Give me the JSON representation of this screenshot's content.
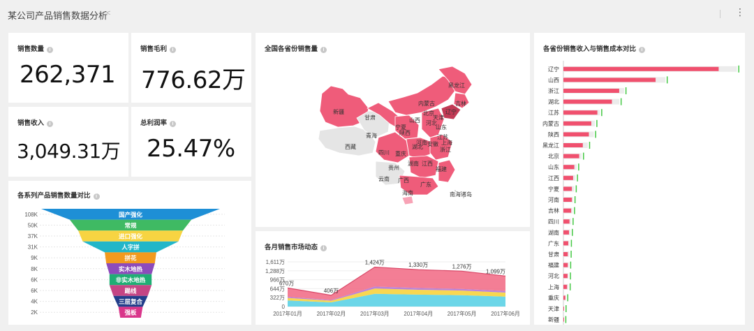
{
  "header": {
    "title": "某公司产品销售数据分析",
    "share_icon": "<",
    "more_icon": "⋮"
  },
  "kpis": [
    {
      "label": "销售数量",
      "value": "262,371"
    },
    {
      "label": "销售毛利",
      "value": "776.62万"
    },
    {
      "label": "销售收入",
      "value": "3,049.31万"
    },
    {
      "label": "总利润率",
      "value": "25.47%"
    }
  ],
  "map": {
    "title": "全国各省份销售量",
    "regions": [
      "新疆",
      "西藏",
      "青海",
      "甘肃",
      "宁夏",
      "内蒙古",
      "黑龙江",
      "吉林",
      "辽宁",
      "北京",
      "天津",
      "山西",
      "陕西",
      "河北",
      "山东",
      "河南",
      "四川",
      "重庆",
      "湖北",
      "安徽",
      "江苏",
      "上海",
      "浙江",
      "湖南",
      "江西",
      "福建",
      "贵州",
      "云南",
      "广西",
      "广东",
      "海南",
      "南海诸岛"
    ]
  },
  "colors": {
    "accent_red": "#f0506e",
    "map_dark": "#c23a55",
    "map_mid": "#ef5c7a",
    "map_light": "#f8a3b6",
    "map_empty": "#e5e5e5",
    "green": "#42c742"
  },
  "chart_data": [
    {
      "type": "funnel",
      "title": "各系列产品销售数量对比",
      "categories": [
        "国产强化",
        "常规",
        "进口强化",
        "人字拼",
        "拼花",
        "实木地热",
        "非实木地热",
        "踢线",
        "三层复合",
        "强板"
      ],
      "tick_labels": [
        "108K",
        "50K",
        "37K",
        "31K",
        "9K",
        "8K",
        "6K",
        "6K",
        "4K",
        "2K"
      ],
      "values": [
        108000,
        50000,
        37000,
        31000,
        9000,
        8000,
        6000,
        6000,
        4000,
        2000
      ],
      "colors": [
        "#1e8fd6",
        "#3fba63",
        "#f7d442",
        "#22b6c9",
        "#f39a1e",
        "#8d4bbb",
        "#1fae74",
        "#c54584",
        "#233e8b",
        "#d9358a"
      ]
    },
    {
      "type": "bar",
      "title": "各省份销售收入与销售成本对比",
      "categories": [
        "辽宁",
        "山西",
        "浙江",
        "湖北",
        "江苏",
        "内蒙古",
        "陕西",
        "黑龙江",
        "北京",
        "山东",
        "江西",
        "宁夏",
        "河南",
        "吉林",
        "四川",
        "湖南",
        "广东",
        "甘肃",
        "福建",
        "河北",
        "上海",
        "重庆",
        "天津",
        "新疆"
      ],
      "series": [
        {
          "name": "",
          "values": [
            640,
            380,
            230,
            200,
            140,
            115,
            105,
            80,
            65,
            45,
            40,
            35,
            35,
            32,
            25,
            23,
            20,
            18,
            18,
            17,
            15,
            8,
            2,
            1
          ]
        },
        {
          "name": "",
          "values": [
            715,
            420,
            250,
            230,
            150,
            130,
            125,
            100,
            75,
            55,
            50,
            45,
            40,
            38,
            32,
            29,
            25,
            24,
            22,
            21,
            20,
            10,
            3,
            2
          ]
        }
      ],
      "xticks": [
        "0",
        "100万",
        "200万",
        "300万",
        "400万",
        "500万",
        "600万",
        "700万"
      ],
      "xlim": [
        0,
        700
      ]
    },
    {
      "type": "area",
      "title": "各月销售市场动态",
      "x": [
        "2017年01月",
        "2017年02月",
        "2017年03月",
        "2017年04月",
        "2017年05月",
        "2017年06月"
      ],
      "totals": [
        670,
        406,
        1424,
        1330,
        1276,
        1099
      ],
      "total_labels": [
        "670万",
        "406万",
        "1,424万",
        "1,330万",
        "1,276万",
        "1,099万"
      ],
      "series": [
        {
          "name": "",
          "color": "#5fd3e6",
          "values": [
            220,
            150,
            460,
            430,
            410,
            360
          ]
        },
        {
          "name": "",
          "color": "#f7d442",
          "values": [
            90,
            60,
            190,
            175,
            165,
            145
          ]
        },
        {
          "name": "",
          "color": "#b57ad6",
          "values": [
            40,
            25,
            70,
            65,
            60,
            55
          ]
        },
        {
          "name": "",
          "color": "#f2738c",
          "values": [
            320,
            171,
            704,
            660,
            641,
            539
          ]
        }
      ],
      "yticks": [
        "0",
        "322万",
        "644万",
        "966万",
        "1,288万",
        "1,611万"
      ],
      "ylim": [
        0,
        1611
      ]
    }
  ]
}
